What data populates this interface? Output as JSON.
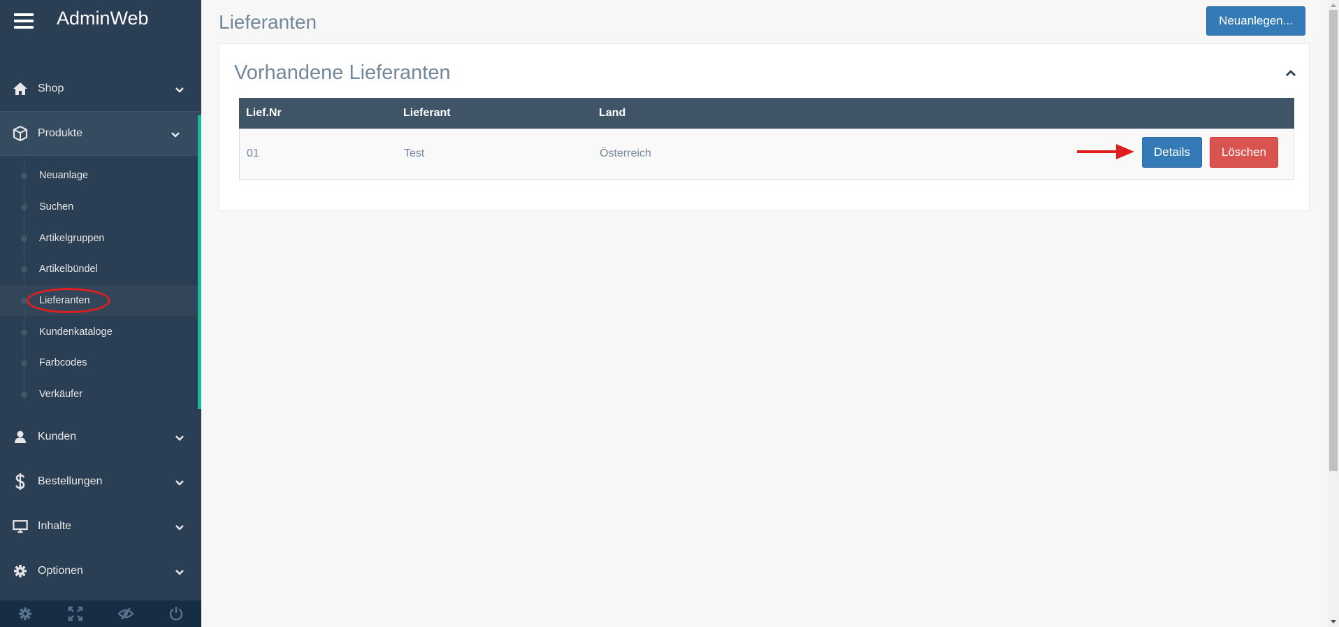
{
  "app": {
    "brand": "AdminWeb"
  },
  "sidebar": {
    "menu_top": [
      {
        "label": "Shop",
        "icon": "home-icon"
      },
      {
        "label": "Produkte",
        "icon": "cube-icon"
      }
    ],
    "sub_items": [
      {
        "label": "Neuanlage"
      },
      {
        "label": "Suchen"
      },
      {
        "label": "Artikelgruppen"
      },
      {
        "label": "Artikelbündel"
      },
      {
        "label": "Lieferanten"
      },
      {
        "label": "Kundenkataloge"
      },
      {
        "label": "Farbcodes"
      },
      {
        "label": "Verkäufer"
      }
    ],
    "menu_bottom": [
      {
        "label": "Kunden",
        "icon": "user-icon"
      },
      {
        "label": "Bestellungen",
        "icon": "dollar-icon"
      },
      {
        "label": "Inhalte",
        "icon": "monitor-icon"
      },
      {
        "label": "Optionen",
        "icon": "gear-icon"
      }
    ],
    "footer_icons": [
      "settings-icon",
      "fullscreen-icon",
      "eye-slash-icon",
      "power-icon"
    ]
  },
  "page": {
    "title": "Lieferanten",
    "new_button": "Neuanlegen..."
  },
  "panel": {
    "title": "Vorhandene Lieferanten",
    "columns": [
      "Lief.Nr",
      "Lieferant",
      "Land"
    ],
    "rows": [
      {
        "nr": "01",
        "name": "Test",
        "land": "Österreich",
        "details": "Details",
        "delete": "Löschen"
      }
    ]
  },
  "colors": {
    "sidebar_bg": "#2a3f54",
    "accent_green": "#1abb9c",
    "primary": "#337ab7",
    "danger": "#d9534f",
    "annotation_red": "#e01e1e"
  }
}
